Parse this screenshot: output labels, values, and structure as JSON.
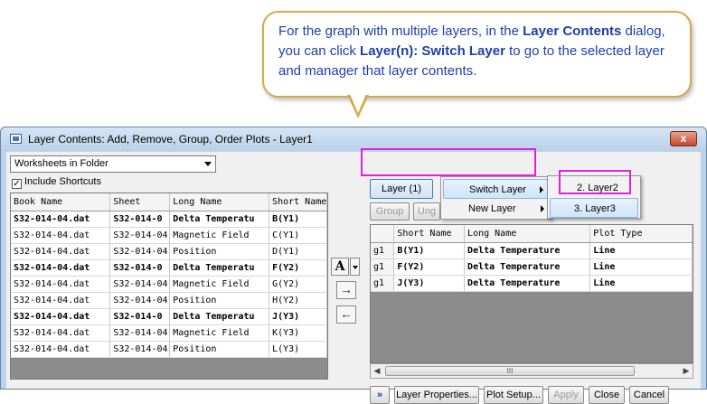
{
  "callout": {
    "line1_pre": "For the graph with multiple layers, in the ",
    "line1_bold": "Layer Contents",
    "line1_post": " dialog,",
    "line2_pre": "you can click ",
    "line2_bold": "Layer(n): Switch Layer",
    "line2_post": " to go to the selected layer",
    "line3": "and manager that layer contents."
  },
  "window": {
    "title": "Layer Contents: Add, Remove, Group, Order Plots - Layer1",
    "close_label": "x"
  },
  "left": {
    "source_combo": "Worksheets in Folder",
    "include_shortcuts_label": "Include Shortcuts",
    "include_shortcuts_checked": true,
    "columns": [
      "Book Name",
      "Sheet",
      "Long Name",
      "Short Name"
    ],
    "rows": [
      {
        "book": "S32-014-04.dat",
        "sheet": "S32-014-0",
        "long": "Delta Temperatu",
        "short": "B(Y1)",
        "bold": true
      },
      {
        "book": "S32-014-04.dat",
        "sheet": "S32-014-04",
        "long": "Magnetic Field",
        "short": "C(Y1)",
        "bold": false
      },
      {
        "book": "S32-014-04.dat",
        "sheet": "S32-014-04",
        "long": "Position",
        "short": "D(Y1)",
        "bold": false
      },
      {
        "book": "S32-014-04.dat",
        "sheet": "S32-014-0",
        "long": "Delta Temperatu",
        "short": "F(Y2)",
        "bold": true
      },
      {
        "book": "S32-014-04.dat",
        "sheet": "S32-014-04",
        "long": "Magnetic Field",
        "short": "G(Y2)",
        "bold": false
      },
      {
        "book": "S32-014-04.dat",
        "sheet": "S32-014-04",
        "long": "Position",
        "short": "H(Y2)",
        "bold": false
      },
      {
        "book": "S32-014-04.dat",
        "sheet": "S32-014-0",
        "long": "Delta Temperatu",
        "short": "J(Y3)",
        "bold": true
      },
      {
        "book": "S32-014-04.dat",
        "sheet": "S32-014-04",
        "long": "Magnetic Field",
        "short": "K(Y3)",
        "bold": false
      },
      {
        "book": "S32-014-04.dat",
        "sheet": "S32-014-04",
        "long": "Position",
        "short": "L(Y3)",
        "bold": false
      }
    ]
  },
  "middle": {
    "font_button": "A",
    "add_arrow": "→",
    "remove_arrow": "←"
  },
  "right": {
    "layer_button": "Layer (1)",
    "group_button": "Group",
    "ungroup_button": "Ung",
    "menu": {
      "switch_layer": "Switch Layer",
      "new_layer": "New Layer"
    },
    "submenu": {
      "layer2": "2. Layer2",
      "layer3": "3. Layer3"
    },
    "columns": [
      "",
      "Short Name",
      "Long Name",
      "Plot Type"
    ],
    "rows": [
      {
        "group": "g1",
        "short": "B(Y1)",
        "long": "Delta Temperature",
        "type": "Line"
      },
      {
        "group": "g1",
        "short": "F(Y2)",
        "long": "Delta Temperature",
        "type": "Line"
      },
      {
        "group": "g1",
        "short": "J(Y3)",
        "long": "Delta Temperature",
        "type": "Line"
      }
    ],
    "scroll_thumb": "III"
  },
  "bottom": {
    "expand": "»",
    "layer_properties": "Layer Properties...",
    "plot_setup": "Plot Setup...",
    "apply": "Apply",
    "close": "Close",
    "cancel": "Cancel"
  },
  "colors": {
    "callout_text": "#1f3fa8",
    "callout_border": "#d8a94a",
    "highlight_box": "#e020e0"
  }
}
